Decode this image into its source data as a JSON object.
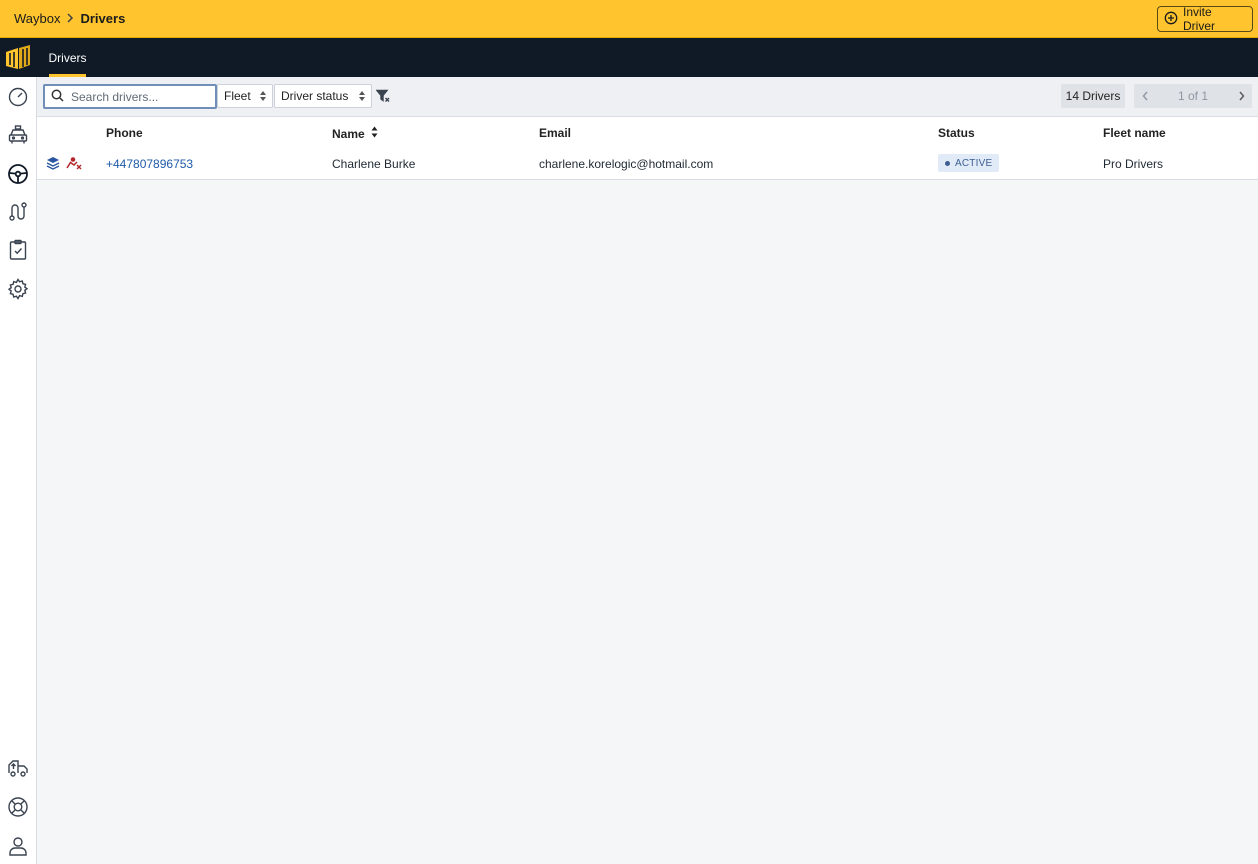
{
  "header": {
    "breadcrumb_root": "Waybox",
    "breadcrumb_current": "Drivers",
    "invite_label": "Invite Driver"
  },
  "nav": {
    "active_tab": "Drivers"
  },
  "colors": {
    "accent": "#ffc42e",
    "nav_bg": "#0f1a26",
    "link": "#1e5aa8",
    "badge_bg": "#e1ebf7"
  },
  "sidebar": {
    "icons": [
      "dashboard-gauge-icon",
      "taxi-icon",
      "steering-wheel-icon",
      "route-icon",
      "clipboard-check-icon",
      "settings-gear-icon",
      "truck-upload-icon",
      "support-lifebuoy-icon",
      "user-account-icon"
    ],
    "active": "steering-wheel-icon"
  },
  "toolbar": {
    "search_placeholder": "Search drivers...",
    "fleet_label": "Fleet",
    "status_label": "Driver status",
    "count_label": "14 Drivers",
    "page_label": "1 of 1"
  },
  "table": {
    "columns": [
      "Phone",
      "Name",
      "Email",
      "Status",
      "Fleet name"
    ],
    "rows": [
      {
        "phone": "+447807896753",
        "name": "Charlene Burke",
        "email": "charlene.korelogic@hotmail.com",
        "status": "ACTIVE",
        "fleet": "Pro Drivers"
      }
    ]
  }
}
